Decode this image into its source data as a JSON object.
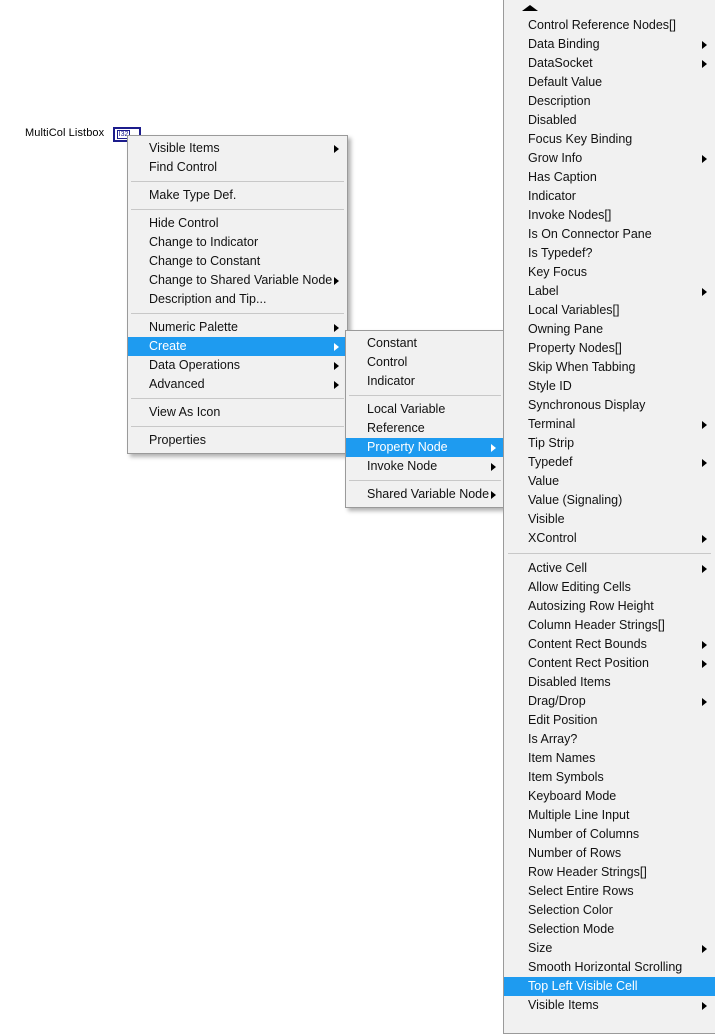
{
  "diagram": {
    "terminal_label": "MultiCol Listbox",
    "terminal_icon": "listbox-terminal-icon",
    "terminal_glyph": "I32"
  },
  "colors": {
    "highlight": "#1e9bf0",
    "highlight_text": "#ffffff",
    "menu_bg": "#f1f1f1",
    "menu_border": "#9a9a9a",
    "separator": "#c8c8c8",
    "text": "#111111",
    "terminal_blue": "#1c1c8c"
  },
  "control_menu": {
    "groups": [
      {
        "items": [
          {
            "label": "Visible Items",
            "submenu": true,
            "selected": false
          },
          {
            "label": "Find Control",
            "submenu": false,
            "selected": false
          }
        ]
      },
      {
        "items": [
          {
            "label": "Make Type Def.",
            "submenu": false,
            "selected": false
          }
        ]
      },
      {
        "items": [
          {
            "label": "Hide Control",
            "submenu": false,
            "selected": false
          },
          {
            "label": "Change to Indicator",
            "submenu": false,
            "selected": false
          },
          {
            "label": "Change to Constant",
            "submenu": false,
            "selected": false
          },
          {
            "label": "Change to Shared Variable Node",
            "submenu": true,
            "selected": false
          },
          {
            "label": "Description and Tip...",
            "submenu": false,
            "selected": false
          }
        ]
      },
      {
        "items": [
          {
            "label": "Numeric Palette",
            "submenu": true,
            "selected": false
          },
          {
            "label": "Create",
            "submenu": true,
            "selected": true
          },
          {
            "label": "Data Operations",
            "submenu": true,
            "selected": false
          },
          {
            "label": "Advanced",
            "submenu": true,
            "selected": false
          }
        ]
      },
      {
        "items": [
          {
            "label": "View As Icon",
            "submenu": false,
            "selected": false
          }
        ]
      },
      {
        "items": [
          {
            "label": "Properties",
            "submenu": false,
            "selected": false
          }
        ]
      }
    ]
  },
  "create_menu": {
    "groups": [
      {
        "items": [
          {
            "label": "Constant",
            "submenu": false,
            "selected": false
          },
          {
            "label": "Control",
            "submenu": false,
            "selected": false
          },
          {
            "label": "Indicator",
            "submenu": false,
            "selected": false
          }
        ]
      },
      {
        "items": [
          {
            "label": "Local Variable",
            "submenu": false,
            "selected": false
          },
          {
            "label": "Reference",
            "submenu": false,
            "selected": false
          },
          {
            "label": "Property Node",
            "submenu": true,
            "selected": true
          },
          {
            "label": "Invoke Node",
            "submenu": true,
            "selected": false
          }
        ]
      },
      {
        "items": [
          {
            "label": "Shared Variable Node",
            "submenu": true,
            "selected": false
          }
        ]
      }
    ]
  },
  "property_menu": {
    "scroll_up_icon": "scroll-up-arrow-icon",
    "groups": [
      {
        "items": [
          {
            "label": "Control Reference Nodes[]",
            "submenu": false,
            "selected": false
          },
          {
            "label": "Data Binding",
            "submenu": true,
            "selected": false
          },
          {
            "label": "DataSocket",
            "submenu": true,
            "selected": false
          },
          {
            "label": "Default Value",
            "submenu": false,
            "selected": false
          },
          {
            "label": "Description",
            "submenu": false,
            "selected": false
          },
          {
            "label": "Disabled",
            "submenu": false,
            "selected": false
          },
          {
            "label": "Focus Key Binding",
            "submenu": false,
            "selected": false
          },
          {
            "label": "Grow Info",
            "submenu": true,
            "selected": false
          },
          {
            "label": "Has Caption",
            "submenu": false,
            "selected": false
          },
          {
            "label": "Indicator",
            "submenu": false,
            "selected": false
          },
          {
            "label": "Invoke Nodes[]",
            "submenu": false,
            "selected": false
          },
          {
            "label": "Is On Connector Pane",
            "submenu": false,
            "selected": false
          },
          {
            "label": "Is Typedef?",
            "submenu": false,
            "selected": false
          },
          {
            "label": "Key Focus",
            "submenu": false,
            "selected": false
          },
          {
            "label": "Label",
            "submenu": true,
            "selected": false
          },
          {
            "label": "Local Variables[]",
            "submenu": false,
            "selected": false
          },
          {
            "label": "Owning Pane",
            "submenu": false,
            "selected": false
          },
          {
            "label": "Property Nodes[]",
            "submenu": false,
            "selected": false
          },
          {
            "label": "Skip When Tabbing",
            "submenu": false,
            "selected": false
          },
          {
            "label": "Style ID",
            "submenu": false,
            "selected": false
          },
          {
            "label": "Synchronous Display",
            "submenu": false,
            "selected": false
          },
          {
            "label": "Terminal",
            "submenu": true,
            "selected": false
          },
          {
            "label": "Tip Strip",
            "submenu": false,
            "selected": false
          },
          {
            "label": "Typedef",
            "submenu": true,
            "selected": false
          },
          {
            "label": "Value",
            "submenu": false,
            "selected": false
          },
          {
            "label": "Value (Signaling)",
            "submenu": false,
            "selected": false
          },
          {
            "label": "Visible",
            "submenu": false,
            "selected": false
          },
          {
            "label": "XControl",
            "submenu": true,
            "selected": false
          }
        ]
      },
      {
        "items": [
          {
            "label": "Active Cell",
            "submenu": true,
            "selected": false
          },
          {
            "label": "Allow Editing Cells",
            "submenu": false,
            "selected": false
          },
          {
            "label": "Autosizing Row Height",
            "submenu": false,
            "selected": false
          },
          {
            "label": "Column Header Strings[]",
            "submenu": false,
            "selected": false
          },
          {
            "label": "Content Rect Bounds",
            "submenu": true,
            "selected": false
          },
          {
            "label": "Content Rect Position",
            "submenu": true,
            "selected": false
          },
          {
            "label": "Disabled Items",
            "submenu": false,
            "selected": false
          },
          {
            "label": "Drag/Drop",
            "submenu": true,
            "selected": false
          },
          {
            "label": "Edit Position",
            "submenu": false,
            "selected": false
          },
          {
            "label": "Is Array?",
            "submenu": false,
            "selected": false
          },
          {
            "label": "Item Names",
            "submenu": false,
            "selected": false
          },
          {
            "label": "Item Symbols",
            "submenu": false,
            "selected": false
          },
          {
            "label": "Keyboard Mode",
            "submenu": false,
            "selected": false
          },
          {
            "label": "Multiple Line Input",
            "submenu": false,
            "selected": false
          },
          {
            "label": "Number of Columns",
            "submenu": false,
            "selected": false
          },
          {
            "label": "Number of Rows",
            "submenu": false,
            "selected": false
          },
          {
            "label": "Row Header Strings[]",
            "submenu": false,
            "selected": false
          },
          {
            "label": "Select Entire Rows",
            "submenu": false,
            "selected": false
          },
          {
            "label": "Selection Color",
            "submenu": false,
            "selected": false
          },
          {
            "label": "Selection Mode",
            "submenu": false,
            "selected": false
          },
          {
            "label": "Size",
            "submenu": true,
            "selected": false
          },
          {
            "label": "Smooth Horizontal Scrolling",
            "submenu": false,
            "selected": false
          },
          {
            "label": "Top Left Visible Cell",
            "submenu": false,
            "selected": true
          },
          {
            "label": "Visible Items",
            "submenu": true,
            "selected": false
          }
        ]
      }
    ]
  }
}
